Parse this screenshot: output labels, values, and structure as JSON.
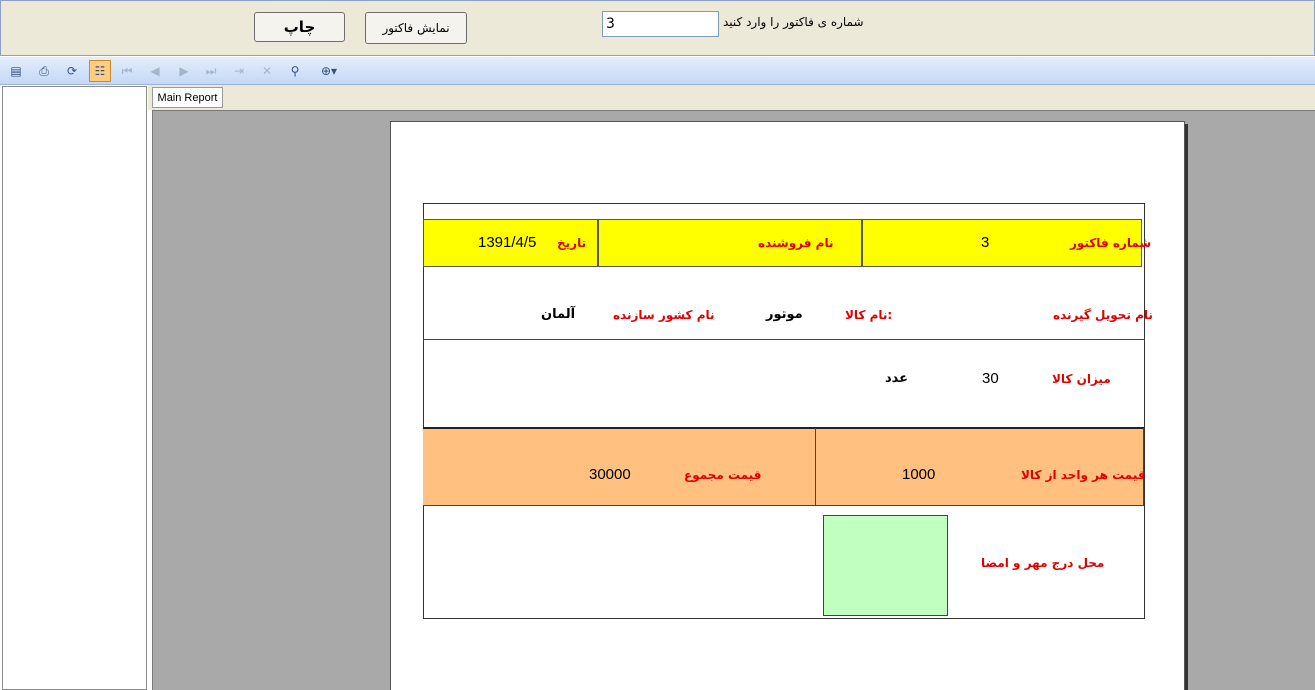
{
  "header": {
    "print_button": "چاپ",
    "show_button": "نمایش فاکتور",
    "invoice_input_value": "3",
    "invoice_input_label": "شماره ی فاکتور را وارد کنید"
  },
  "toolbar": {
    "icons": [
      "export-icon",
      "print-icon",
      "refresh-icon",
      "group-tree-icon",
      "first-page-icon",
      "prev-page-icon",
      "next-page-icon",
      "last-page-icon",
      "goto-page-icon",
      "stop-icon",
      "search-icon",
      "zoom-icon"
    ]
  },
  "tabs": {
    "main": "Main Report"
  },
  "report": {
    "invoice_no_label": "شماره فاکتور",
    "invoice_no": "3",
    "seller_label": "نام فروشنده",
    "date_label": "تاریخ",
    "date": "1391/4/5",
    "receiver_label": "نام تحویل گیرنده",
    "product_label": ":نام کالا",
    "product": "موتور",
    "country_label": "نام کشور سازنده",
    "country": "آلمان",
    "quantity_label": "میزان  کالا",
    "quantity": "30",
    "unit": "عدد",
    "unit_price_label": "قیمت هر واحد از کالا",
    "unit_price": "1000",
    "total_label": "قیمت مجموع",
    "total": "30000",
    "stamp_label": "محل درج مهر و امضا"
  },
  "colors": {
    "header_band": "#ffff00",
    "price_band": "#ffc080",
    "stamp_box": "#c0ffc0",
    "label_red": "#e00000"
  }
}
